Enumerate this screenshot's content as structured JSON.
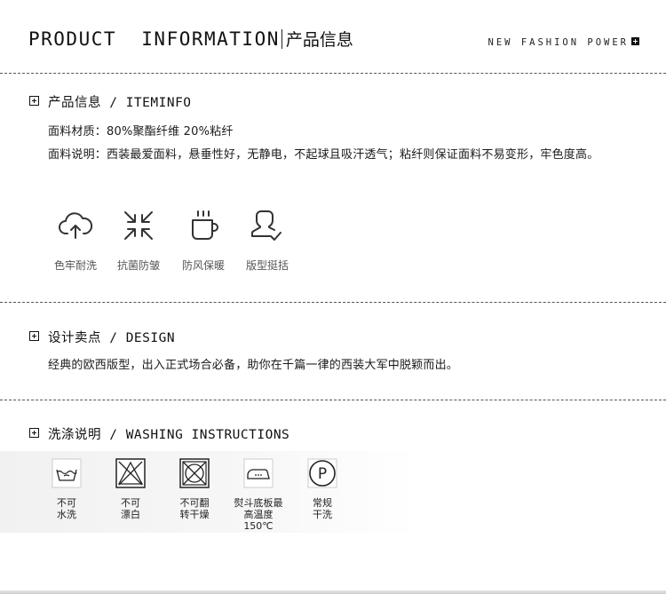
{
  "header": {
    "title_en": "PRODUCT  INFORMATION",
    "title_cn": "产品信息",
    "tagline": "NEW FASHION POWER"
  },
  "sections": {
    "info": {
      "title": "产品信息 / ITEMINFO",
      "material": "面料材质：80%聚酯纤维 20%粘纤",
      "description": "面料说明：西装最爱面料，悬垂性好，无静电，不起球且吸汗透气；粘纤则保证面料不易变形，牢色度高。"
    },
    "design": {
      "title": "设计卖点 / DESIGN",
      "text": "经典的欧西版型，出入正式场合必备，助你在千篇一律的西装大军中脱颖而出。"
    },
    "washing": {
      "title": "洗涤说明 / WASHING INSTRUCTIONS"
    }
  },
  "features": [
    {
      "icon": "cloud-upload-icon",
      "label": "色牢耐洗"
    },
    {
      "icon": "shrink-arrows-icon",
      "label": "抗菌防皱"
    },
    {
      "icon": "hot-cup-icon",
      "label": "防风保暖"
    },
    {
      "icon": "user-check-icon",
      "label": "版型挺括"
    }
  ],
  "wash_items": [
    {
      "icon": "hand-wash-icon",
      "line1": "不可",
      "line2": "水洗"
    },
    {
      "icon": "no-bleach-icon",
      "line1": "不可",
      "line2": "漂白"
    },
    {
      "icon": "no-tumble-dry-icon",
      "line1": "不可翻",
      "line2": "转干燥"
    },
    {
      "icon": "iron-icon",
      "line1": "熨斗底板最",
      "line2": "高温度150℃"
    },
    {
      "icon": "dry-clean-p-icon",
      "line1": "常规",
      "line2": "干洗"
    }
  ]
}
